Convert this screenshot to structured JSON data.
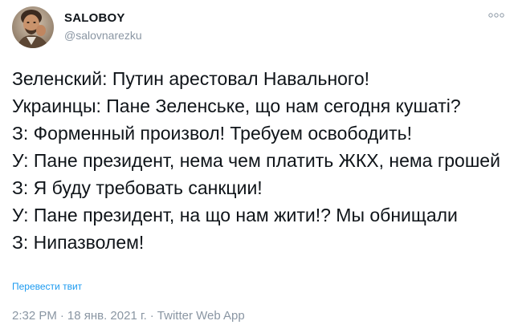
{
  "author": {
    "display_name": "SALOBOY",
    "handle": "@salovnarezku",
    "avatar_icon": "profile-photo"
  },
  "menu": {
    "more_icon": "more-dots-icon"
  },
  "tweet": {
    "lines": [
      "Зеленский: Путин арестовал Навального!",
      "Украинцы: Пане Зеленське, що нам сегодня кушаті?",
      "З: Форменный произвол! Требуем освободить!",
      "У: Пане президент, нема чем платить ЖКХ, нема грошей",
      "З: Я буду требовать санкции!",
      "У: Пане президент, на що нам жити!? Мы обнищали",
      "З: Нипазволем!"
    ],
    "translate_label": "Перевести твит"
  },
  "meta": {
    "time": "2:32 PM",
    "date": "18 янв. 2021 г.",
    "source": "Twitter Web App",
    "separator": "·"
  },
  "colors": {
    "text": "#0f1419",
    "secondary": "#8a96a3",
    "link": "#1d9bf0"
  }
}
